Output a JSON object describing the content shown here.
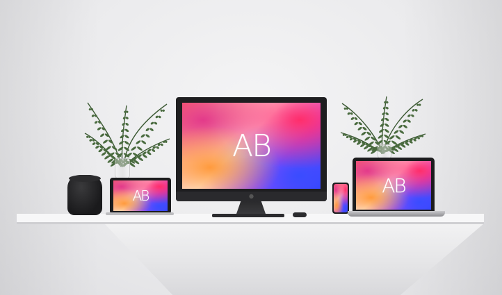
{
  "scene": {
    "imac_logo": "AB",
    "tablet_logo": "AB",
    "laptop_logo": "AB",
    "phone_logo": "",
    "apple_glyph": "",
    "colors": {
      "wall": "#ebebed",
      "desk": "#f7f7f8",
      "device_dark": "#1e1e20",
      "fern_green": "#3d5a35"
    }
  }
}
